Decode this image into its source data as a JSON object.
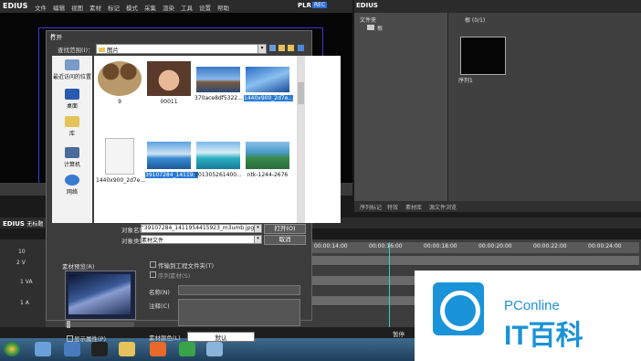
{
  "app": {
    "name": "EDIUS",
    "menu": [
      "文件",
      "编辑",
      "视图",
      "素材",
      "标记",
      "模式",
      "采集",
      "渲染",
      "工具",
      "设置",
      "帮助"
    ],
    "plr": "PLR",
    "rec": "REC"
  },
  "bin": {
    "folder_label": "文件夹",
    "tree_root": "根",
    "clip_header": "根 (0/1)",
    "clip_name": "序列1",
    "tabs": [
      "序列标记",
      "特效",
      "素材库",
      "源文件浏览"
    ]
  },
  "timeline": {
    "title": "EDIUS",
    "subtitle": "无标题",
    "tracks": [
      "2 V",
      "1 VA",
      "1 A"
    ],
    "track_number": "10",
    "ticks": [
      "00:00:14:00",
      "00:00:16:00",
      "00:00:18:00",
      "00:00:20:00",
      "00:00:22:00",
      "00:00:24:00"
    ],
    "status_pause": "暂停"
  },
  "dialog": {
    "title": "打开",
    "lookin_label": "查找范围(I)：",
    "lookin_value": "图片",
    "places": [
      "最近访问的位置",
      "桌面",
      "库",
      "计算机",
      "网络"
    ],
    "files": [
      {
        "name": "9",
        "thumb": "collage"
      },
      {
        "name": "00011",
        "thumb": "girl"
      },
      {
        "name": "370ace8df5322...",
        "thumb": "landscape"
      },
      {
        "name": "1440x900_2d7e...",
        "thumb": "blue",
        "selected": true
      },
      {
        "name": "1440x900_2d7e...",
        "thumb": "doc"
      },
      {
        "name": "39107284_14119...",
        "thumb": "sea",
        "selected": true
      },
      {
        "name": "201305261400...",
        "thumb": "beach"
      },
      {
        "name": "ntk-1244-2676",
        "thumb": "lake"
      }
    ],
    "filename_label": "对象名称(N)：",
    "filename_value": "\"39107284_1411954415923_m3umb.jpg\" \"14",
    "filetype_label": "对象类型(T)：",
    "filetype_value": "素材文件",
    "open_button": "打开(O)",
    "cancel_button": "取消",
    "preview_label": "素材预览(R)",
    "show_props": "显示属性(P)",
    "transfer_label": "传输到工程文件夹(T)",
    "sequence_label": "序列素材(S)",
    "name_label": "名称(N)",
    "note_label": "注释(C)",
    "color_label": "素材颜色(L)",
    "default_button": "默认"
  },
  "watermark": {
    "brand": "PConline",
    "big": "IT百科"
  }
}
